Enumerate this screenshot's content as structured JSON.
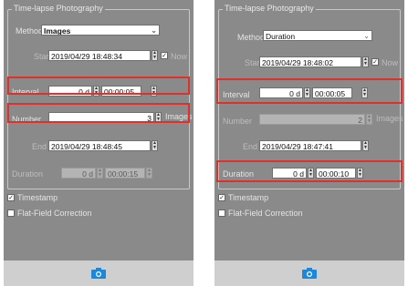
{
  "left": {
    "group_title": "Time-lapse Photography",
    "method_label": "Method",
    "method_value": "Images",
    "start_label": "Start",
    "start_value": "2019/04/29 18:48:34",
    "now_label": "Now",
    "interval_label": "Interval",
    "interval_days": "0 d",
    "interval_time": "00:00:05",
    "number_label": "Number",
    "number_value": "3",
    "number_unit": "Images",
    "end_label": "End",
    "end_value": "2019/04/29 18:48:45",
    "duration_label": "Duration",
    "duration_days": "0 d",
    "duration_time": "00:00:15",
    "timestamp_label": "Timestamp",
    "flatfield_label": "Flat-Field Correction"
  },
  "right": {
    "group_title": "Time-lapse Photography",
    "method_label": "Method",
    "method_value": "Duration",
    "start_label": "Start",
    "start_value": "2019/04/29 18:48:02",
    "now_label": "Now",
    "interval_label": "Interval",
    "interval_days": "0 d",
    "interval_time": "00:00:05",
    "number_label": "Number",
    "number_value": "2",
    "number_unit": "Images",
    "end_label": "End",
    "end_value": "2019/04/29 18:47:41",
    "duration_label": "Duration",
    "duration_days": "0 d",
    "duration_time": "00:00:10",
    "timestamp_label": "Timestamp",
    "flatfield_label": "Flat-Field Correction"
  },
  "colors": {
    "panel_bg": "#8a8a8a",
    "highlight": "#e0302c",
    "camera_icon": "#1e88d8"
  },
  "icons": {
    "camera": "camera-icon",
    "spin": "spin-updown-icon",
    "dropdown": "chevron-down-icon"
  }
}
